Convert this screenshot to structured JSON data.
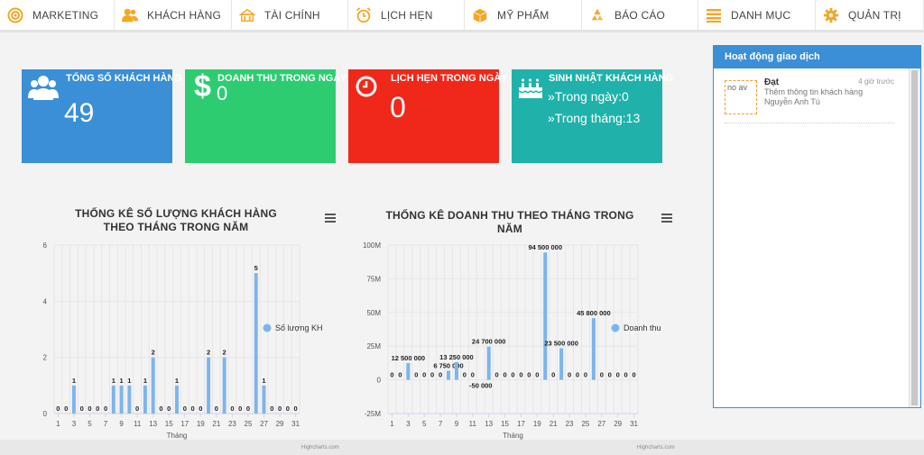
{
  "nav": [
    {
      "label": "MARKETING",
      "icon": "target-icon",
      "color": "#f5a623",
      "width": 127
    },
    {
      "label": "KHÁCH HÀNG",
      "icon": "users-icon",
      "color": "#f5a623",
      "width": 130
    },
    {
      "label": "TÀI CHÍNH",
      "icon": "finance-icon",
      "color": "#f5a623",
      "width": 129
    },
    {
      "label": "LỊCH HẸN",
      "icon": "alarm-clock-icon",
      "color": "#f5a623",
      "width": 129
    },
    {
      "label": "MỸ PHẨM",
      "icon": "box-icon",
      "color": "#f5a623",
      "width": 130
    },
    {
      "label": "BÁO CÁO",
      "icon": "recycle-icon",
      "color": "#f5a623",
      "width": 129
    },
    {
      "label": "DANH MỤC",
      "icon": "list-icon",
      "color": "#f5a623",
      "width": 130
    },
    {
      "label": "QUẢN TRỊ",
      "icon": "gear-icon",
      "color": "#f5a623",
      "width": 120
    }
  ],
  "cards": [
    {
      "title": "TỔNG SỐ KHÁCH HÀNG",
      "value": "49",
      "color": "#3a8fd6",
      "icon": "people-icon"
    },
    {
      "title": "DOANH THU TRONG NGÀY",
      "value": "0",
      "color": "#2ecc71",
      "icon": "dollar-icon"
    },
    {
      "title": "LỊCH HẸN TRONG NGÀY",
      "value": "0",
      "color": "#f0281a",
      "icon": "clock-icon"
    },
    {
      "title": "SINH NHẬT KHÁCH HÀNG",
      "color": "#20b2aa",
      "icon": "cake-icon",
      "line1": "»Trong ngày:0",
      "line2": "»Trong tháng:13"
    }
  ],
  "activity_panel": {
    "title": "Hoạt động giao dịch",
    "items": [
      {
        "avatar_alt": "no av",
        "name": "Đạt",
        "time": "4 giờ trước",
        "desc": "Thêm thông tin khách hàng Nguyễn Anh Tú"
      }
    ]
  },
  "chart_data": [
    {
      "type": "bar",
      "title": "THỐNG KÊ SỐ LƯỢNG KHÁCH HÀNG THEO THÁNG TRONG NĂM",
      "xlabel": "Tháng",
      "ylabel": "",
      "ylim": [
        0,
        6
      ],
      "yticks": [
        "0",
        "2",
        "4",
        "6"
      ],
      "xticks": [
        "1",
        "3",
        "5",
        "7",
        "9",
        "11",
        "13",
        "15",
        "17",
        "19",
        "21",
        "23",
        "25",
        "27",
        "29",
        "31"
      ],
      "x": [
        1,
        2,
        3,
        4,
        5,
        6,
        7,
        8,
        9,
        10,
        11,
        12,
        13,
        14,
        15,
        16,
        17,
        18,
        19,
        20,
        21,
        22,
        23,
        24,
        25,
        26,
        27,
        28,
        29,
        30,
        31
      ],
      "series": [
        {
          "name": "Số lượng KH",
          "values": [
            0,
            0,
            1,
            0,
            0,
            0,
            0,
            1,
            1,
            1,
            0,
            1,
            2,
            0,
            0,
            1,
            0,
            0,
            0,
            2,
            0,
            2,
            0,
            0,
            0,
            5,
            1,
            0,
            0,
            0,
            0
          ]
        }
      ],
      "data_labels": [
        "0",
        "0",
        "1",
        "0",
        "0",
        "0",
        "0",
        "1",
        "1",
        "1",
        "0",
        "1",
        "2",
        "0",
        "0",
        "1",
        "0",
        "0",
        "0",
        "2",
        "0",
        "2",
        "0",
        "0",
        "0",
        "5",
        "1",
        "0",
        "0",
        "0",
        "0"
      ],
      "legend": "right",
      "color": "#7cb5ec",
      "grid": true,
      "credits": "Highcharts.com"
    },
    {
      "type": "bar",
      "title": "THỐNG KÊ DOANH THU THEO THÁNG TRONG NĂM",
      "xlabel": "Tháng",
      "ylabel": "",
      "ylim": [
        -25000000,
        100000000
      ],
      "yticks": [
        "-25M",
        "0",
        "25M",
        "50M",
        "75M",
        "100M"
      ],
      "xticks": [
        "1",
        "3",
        "5",
        "7",
        "9",
        "11",
        "13",
        "15",
        "17",
        "19",
        "21",
        "23",
        "25",
        "27",
        "29",
        "31"
      ],
      "x": [
        1,
        2,
        3,
        4,
        5,
        6,
        7,
        8,
        9,
        10,
        11,
        12,
        13,
        14,
        15,
        16,
        17,
        18,
        19,
        20,
        21,
        22,
        23,
        24,
        25,
        26,
        27,
        28,
        29,
        30,
        31
      ],
      "series": [
        {
          "name": "Doanh thu",
          "values": [
            0,
            0,
            12500000,
            0,
            0,
            0,
            0,
            6750000,
            13250000,
            0,
            0,
            -50000,
            24700000,
            0,
            0,
            0,
            0,
            0,
            0,
            94500000,
            0,
            23500000,
            0,
            0,
            0,
            45800000,
            0,
            0,
            0,
            0,
            0
          ]
        }
      ],
      "data_labels": [
        "0",
        "0",
        "12 500 000",
        "0",
        "0",
        "0",
        "0",
        "6 750 000",
        "13 250 000",
        "0",
        "0",
        "-50 000",
        "24 700 000",
        "0",
        "0",
        "0",
        "0",
        "0",
        "0",
        "94 500 000",
        "0",
        "23 500 000",
        "0",
        "0",
        "0",
        "45 800 000",
        "0",
        "0",
        "0",
        "0",
        "0"
      ],
      "legend": "right",
      "color": "#7cb5ec",
      "grid": true,
      "credits": "Highcharts.com"
    }
  ]
}
